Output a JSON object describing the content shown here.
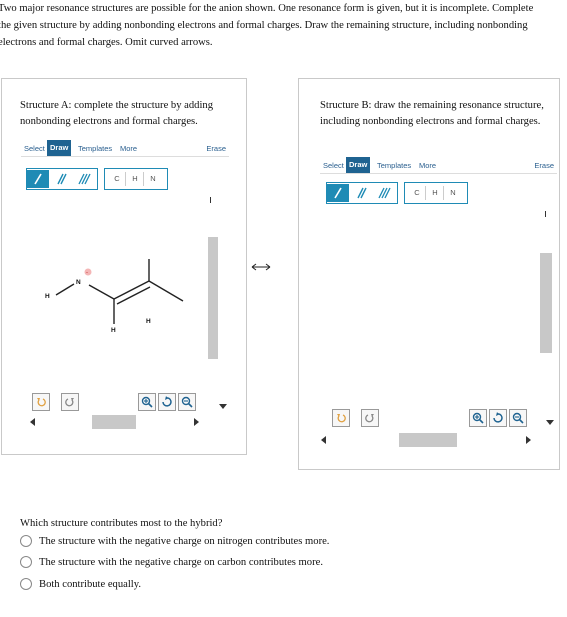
{
  "question": {
    "line1": "Two major resonance structures are possible for the anion shown. One resonance form is given, but it is incomplete. Complete",
    "line2": "the given structure by adding nonbonding electrons and formal charges. Draw the remaining structure, including nonbonding",
    "line3": "electrons and formal charges. Omit curved arrows."
  },
  "panel_a": {
    "prompt": "Structure A: complete the structure by adding nonbonding electrons and formal charges.",
    "toolbar": {
      "select": "Select",
      "draw": "Draw",
      "templates": "Templates",
      "more": "More",
      "erase": "Erase"
    },
    "atoms": {
      "c": "C",
      "h": "H",
      "n": "N"
    },
    "molecule": {
      "n_label": "N",
      "h_top": "H",
      "h_left": "H",
      "h_bottom": "H",
      "charge": "-"
    }
  },
  "panel_b": {
    "prompt": "Structure B: draw the remaining resonance structure, including nonbonding electrons and formal charges.",
    "toolbar": {
      "select": "Select",
      "draw": "Draw",
      "templates": "Templates",
      "more": "More",
      "erase": "Erase"
    },
    "atoms": {
      "c": "C",
      "h": "H",
      "n": "N"
    }
  },
  "resonance_arrow": "⟷",
  "mcq": {
    "question": "Which structure contributes most to the hybrid?",
    "options": [
      "The structure with the negative charge on nitrogen contributes more.",
      "The structure with the negative charge on carbon contributes more.",
      "Both contribute equally."
    ],
    "selected": null
  },
  "colors": {
    "accent": "#1f8bb5",
    "draw_tab": "#1f6391",
    "charge": "#e07070"
  },
  "icons": [
    "undo-icon",
    "redo-icon",
    "zoom-in-icon",
    "reset-zoom-icon",
    "zoom-out-icon",
    "single-bond-icon",
    "double-bond-icon",
    "triple-bond-icon"
  ]
}
